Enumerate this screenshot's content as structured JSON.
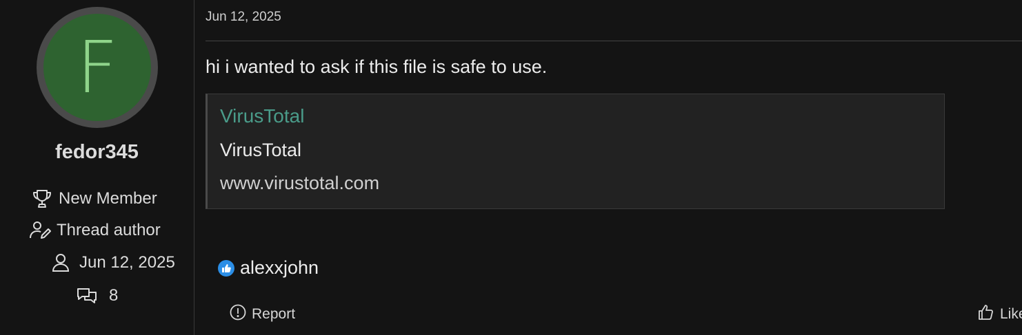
{
  "user": {
    "avatar_letter": "F",
    "avatar_bg": "#2e6330",
    "avatar_fg": "#8fd48a",
    "name": "fedor345",
    "rank": "New Member",
    "role": "Thread author",
    "joined": "Jun 12, 2025",
    "messages": "8"
  },
  "post": {
    "date": "Jun 12, 2025",
    "text": "hi i wanted to ask if this file is safe to use.",
    "embed": {
      "title": "VirusTotal",
      "description": "VirusTotal",
      "url": "www.virustotal.com",
      "title_color": "#4a9c8a"
    },
    "reactions": {
      "icon": "thumbs-up-icon",
      "users": "alexxjohn"
    },
    "actions": {
      "report_label": "Report",
      "like_label": "Like"
    }
  }
}
